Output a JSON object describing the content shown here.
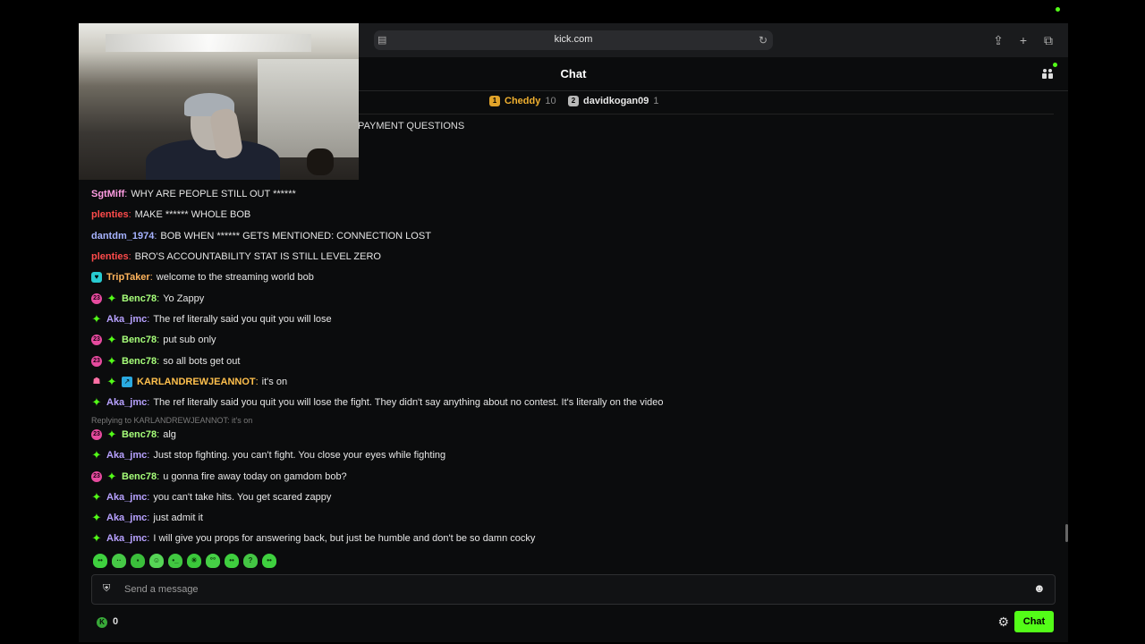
{
  "browser": {
    "url": "kick.com"
  },
  "header": {
    "title": "Chat"
  },
  "leaderboard": [
    {
      "rank": "1",
      "name": "Cheddy",
      "count": "10",
      "color": "#e0a32a",
      "name_color": "#f0b030"
    },
    {
      "rank": "2",
      "name": "davidkogan09",
      "count": "1",
      "color": "#b8b8b8",
      "name_color": "#e6e6e6"
    }
  ],
  "pinned": {
    "text": "PAYMENT QUESTIONS"
  },
  "messages": [
    {
      "badges": [],
      "user": "SgtMiff",
      "color": "#ff9de2",
      "text": "WHY ARE PEOPLE STILL OUT ******"
    },
    {
      "badges": [],
      "user": "plenties",
      "color": "#ff4b4b",
      "text": "MAKE ****** WHOLE BOB"
    },
    {
      "badges": [],
      "user": "dantdm_1974",
      "color": "#a6b3ff",
      "text": "BOB WHEN ****** GETS MENTIONED: CONNECTION LOST"
    },
    {
      "badges": [],
      "user": "plenties",
      "color": "#ff4b4b",
      "text": "BRO'S ACCOUNTABILITY STAT IS STILL LEVEL ZERO"
    },
    {
      "badges": [
        "og"
      ],
      "user": "TripTaker",
      "color": "#ffb45c",
      "text": "welcome to the streaming world bob"
    },
    {
      "badges": [
        "sub",
        "spark"
      ],
      "user": "Benc78",
      "color": "#a7ff7a",
      "text": "Yo Zappy"
    },
    {
      "badges": [
        "spark"
      ],
      "user": "Aka_jmc",
      "color": "#b7a1ff",
      "text": "The ref literally said you quit you will lose"
    },
    {
      "badges": [
        "sub",
        "spark"
      ],
      "user": "Benc78",
      "color": "#a7ff7a",
      "text": "put sub only"
    },
    {
      "badges": [
        "sub",
        "spark"
      ],
      "user": "Benc78",
      "color": "#a7ff7a",
      "text": "so all bots get out"
    },
    {
      "badges": [
        "gift",
        "spark",
        "pin"
      ],
      "user": "KARLANDREWJEANNOT",
      "color": "#ffc04d",
      "text": "it's on"
    },
    {
      "badges": [
        "spark"
      ],
      "user": "Aka_jmc",
      "color": "#b7a1ff",
      "text": "The ref literally said you quit you will lose the fight. They didn't say anything about no contest. It's literally on the video"
    },
    {
      "badges": [
        "sub",
        "spark"
      ],
      "user": "Benc78",
      "color": "#a7ff7a",
      "text": "alg",
      "reply": "Replying to KARLANDREWJEANNOT: it's on"
    },
    {
      "badges": [
        "spark"
      ],
      "user": "Aka_jmc",
      "color": "#b7a1ff",
      "text": "Just stop fighting. you can't fight. You close your eyes while fighting"
    },
    {
      "badges": [
        "sub",
        "spark"
      ],
      "user": "Benc78",
      "color": "#a7ff7a",
      "text": "u gonna fire away today on gamdom bob?"
    },
    {
      "badges": [
        "spark"
      ],
      "user": "Aka_jmc",
      "color": "#b7a1ff",
      "text": "you can't take hits. You get scared zappy"
    },
    {
      "badges": [
        "spark"
      ],
      "user": "Aka_jmc",
      "color": "#b7a1ff",
      "text": "just admit it"
    },
    {
      "badges": [
        "spark"
      ],
      "user": "Aka_jmc",
      "color": "#b7a1ff",
      "text": "I will give you props for answering back, but just be humble and don't be so damn cocky"
    }
  ],
  "emotes": [
    "emote-1",
    "emote-2",
    "emote-3",
    "emote-4",
    "emote-5",
    "emote-6",
    "emote-7",
    "emote-8",
    "emote-9",
    "emote-10"
  ],
  "input": {
    "placeholder": "Send a message"
  },
  "footer": {
    "points": "0",
    "chat_label": "Chat"
  },
  "colors": {
    "accent": "#53fc18"
  }
}
